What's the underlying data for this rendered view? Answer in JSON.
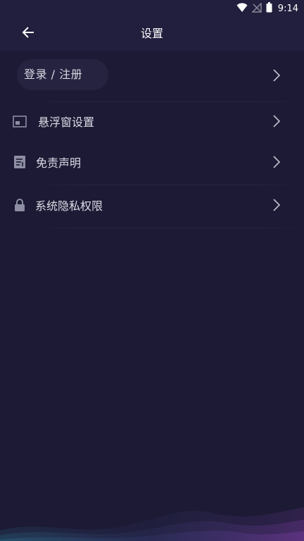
{
  "status_bar": {
    "time": "9:14",
    "icons": [
      "wifi-icon",
      "no-signal-icon",
      "battery-icon"
    ]
  },
  "app_bar": {
    "title": "设置",
    "back_icon": "arrow-left-icon"
  },
  "login": {
    "label": "登录 / 注册"
  },
  "menu": {
    "items": [
      {
        "label": "悬浮窗设置",
        "icon": "floating-window-icon"
      },
      {
        "label": "免责声明",
        "icon": "document-icon"
      },
      {
        "label": "系统隐私权限",
        "icon": "lock-icon"
      }
    ]
  },
  "colors": {
    "background": "#1c1a34",
    "app_bar": "#221e3d",
    "pill": "#25233f",
    "text": "#dcdce6",
    "icon": "#8d8ea4"
  }
}
